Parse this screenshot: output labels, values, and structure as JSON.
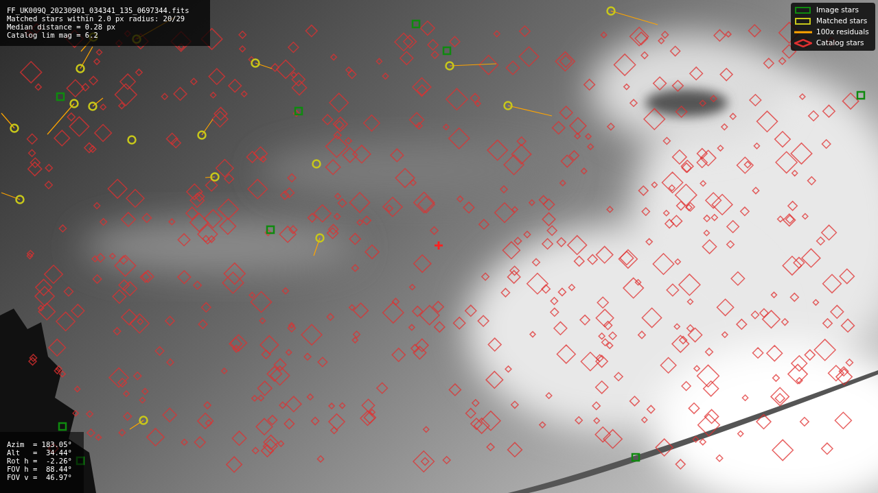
{
  "info_panel": {
    "lines": [
      "FF_UK009Q_20230901_034341_135_0697344.fits",
      "Matched stars within 2.0 px radius: 20/29",
      "Median distance = 0.28 px",
      "Catalog lim mag = 6.2"
    ]
  },
  "legend": {
    "items": [
      {
        "kind": "image_stars",
        "label": "Image stars",
        "color": "#0f8a0f"
      },
      {
        "kind": "matched_stars",
        "label": "Matched stars",
        "color": "#c8c81a"
      },
      {
        "kind": "residuals",
        "label": "100x residuals",
        "color": "#ffa500"
      },
      {
        "kind": "catalog_stars",
        "label": "Catalog stars",
        "color": "#e03030"
      }
    ]
  },
  "pointing_panel": {
    "lines": [
      "Azim  = 183.05°",
      "Alt   =  34.44°",
      "Rot h =  -2.26°",
      "FOV h =  88.44°",
      "FOV v =  46.97°"
    ]
  }
}
